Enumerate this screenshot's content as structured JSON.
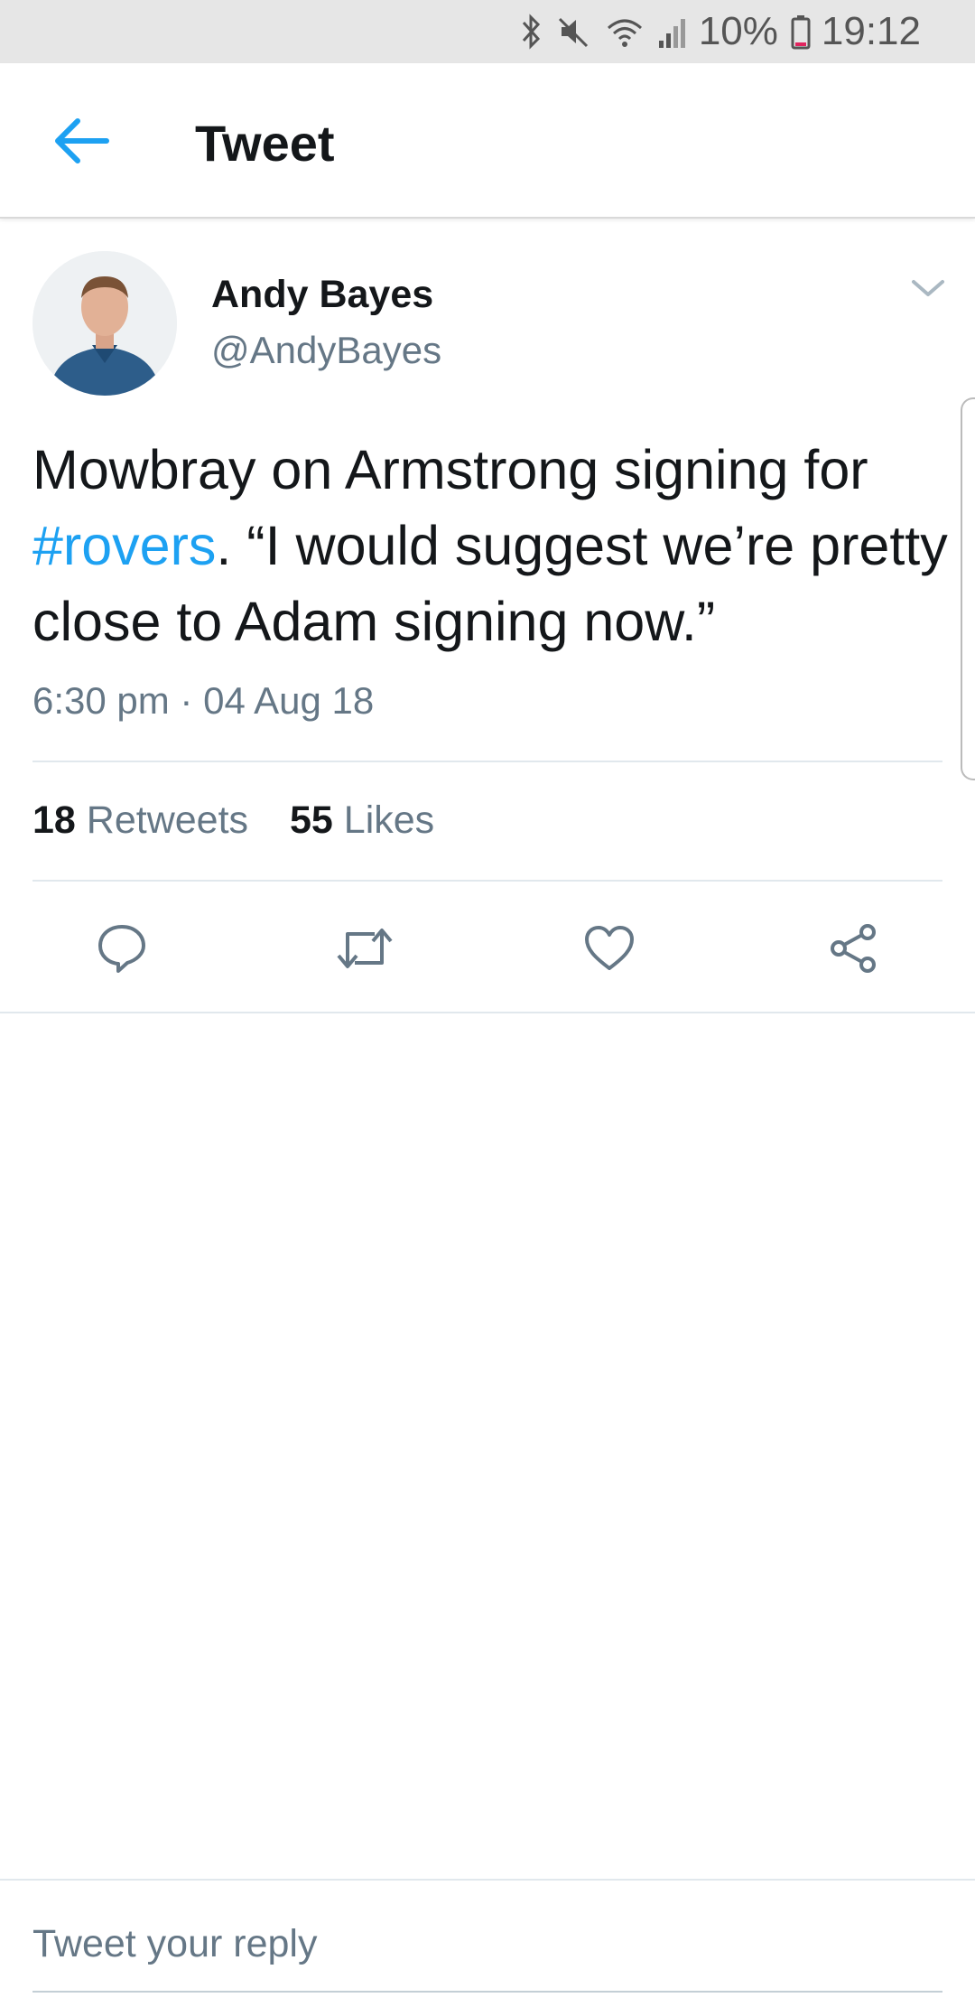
{
  "status_bar": {
    "battery": "10%",
    "time": "19:12",
    "icons": [
      "bluetooth-icon",
      "mute-icon",
      "wifi-icon",
      "signal-icon",
      "battery-icon"
    ]
  },
  "app_bar": {
    "back_icon": "back-arrow-icon",
    "title": "Tweet"
  },
  "tweet": {
    "author_name": "Andy Bayes",
    "author_handle": "@AndyBayes",
    "text_before": "Mowbray on Armstrong signing for ",
    "hashtag": "#rovers",
    "text_after": ". “I would suggest we’re pretty close to Adam signing now.”",
    "timestamp": "6:30 pm · 04 Aug 18",
    "retweet_count": "18",
    "retweet_label": "Retweets",
    "like_count": "55",
    "like_label": "Likes"
  },
  "actions": [
    "reply-icon",
    "retweet-icon",
    "like-icon",
    "share-icon"
  ],
  "reply": {
    "placeholder": "Tweet your reply"
  },
  "colors": {
    "accent": "#1da1f2",
    "secondary_text": "#657786",
    "primary_text": "#14171a",
    "status_bar_bg": "#e6e6e6"
  }
}
